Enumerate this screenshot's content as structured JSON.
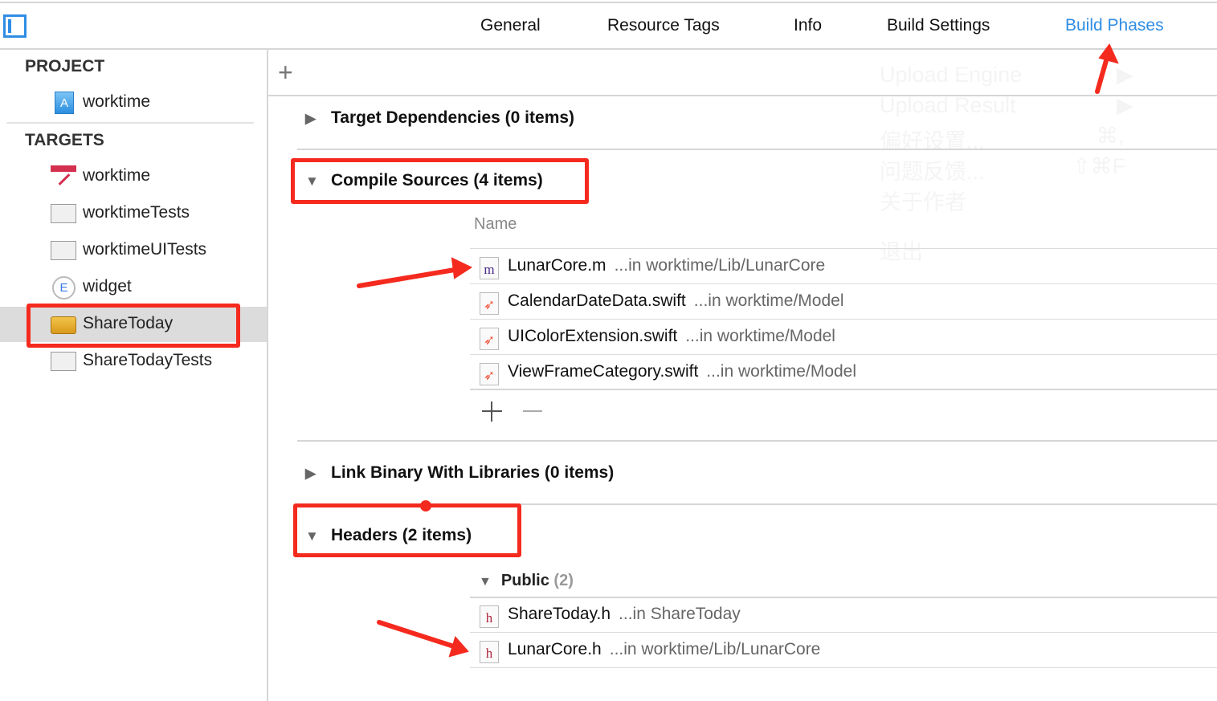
{
  "toolbar": {
    "tabs": [
      {
        "label": "General"
      },
      {
        "label": "Resource Tags"
      },
      {
        "label": "Info"
      },
      {
        "label": "Build Settings"
      },
      {
        "label": "Build Phases",
        "active": true
      }
    ],
    "accent": "#2f8de4"
  },
  "sidebar": {
    "project_header": "PROJECT",
    "project": {
      "label": "worktime",
      "icon": "xcode-project-icon"
    },
    "targets_header": "TARGETS",
    "targets": [
      {
        "label": "worktime",
        "icon": "app-calendar-icon"
      },
      {
        "label": "worktimeTests",
        "icon": "test-bundle-icon"
      },
      {
        "label": "worktimeUITests",
        "icon": "test-bundle-icon"
      },
      {
        "label": "widget",
        "icon": "extension-icon"
      },
      {
        "label": "ShareToday",
        "icon": "toolbox-icon",
        "selected": true
      },
      {
        "label": "ShareTodayTests",
        "icon": "test-bundle-icon"
      }
    ]
  },
  "main": {
    "add_label": "+",
    "target_dependencies": "Target Dependencies (0 items)",
    "compile_sources": {
      "title": "Compile Sources (4 items)",
      "column": "Name",
      "files": [
        {
          "name": "LunarCore.m",
          "path": "...in worktime/Lib/LunarCore",
          "icon": "m"
        },
        {
          "name": "CalendarDateData.swift",
          "path": "...in worktime/Model",
          "icon": "swift"
        },
        {
          "name": "UIColorExtension.swift",
          "path": "...in worktime/Model",
          "icon": "swift"
        },
        {
          "name": "ViewFrameCategory.swift",
          "path": "...in worktime/Model",
          "icon": "swift"
        }
      ]
    },
    "link_binary": "Link Binary With Libraries (0 items)",
    "headers": {
      "title": "Headers (2 items)",
      "group": "Public",
      "group_count": "(2)",
      "files": [
        {
          "name": "ShareToday.h",
          "path": "...in ShareToday",
          "icon": "h"
        },
        {
          "name": "LunarCore.h",
          "path": "...in worktime/Lib/LunarCore",
          "icon": "h"
        }
      ]
    }
  },
  "ghost_menu": [
    {
      "label": "Upload Engine",
      "shortcut": "▶"
    },
    {
      "label": "Upload Result",
      "shortcut": "▶"
    },
    {
      "label": "偏好设置...",
      "shortcut": "⌘,"
    },
    {
      "label": "问题反馈...",
      "shortcut": "⇧⌘F"
    },
    {
      "label": "关于作者",
      "shortcut": ""
    },
    {
      "label": "退出",
      "shortcut": ""
    }
  ],
  "annotation_color": "#f52a1e"
}
